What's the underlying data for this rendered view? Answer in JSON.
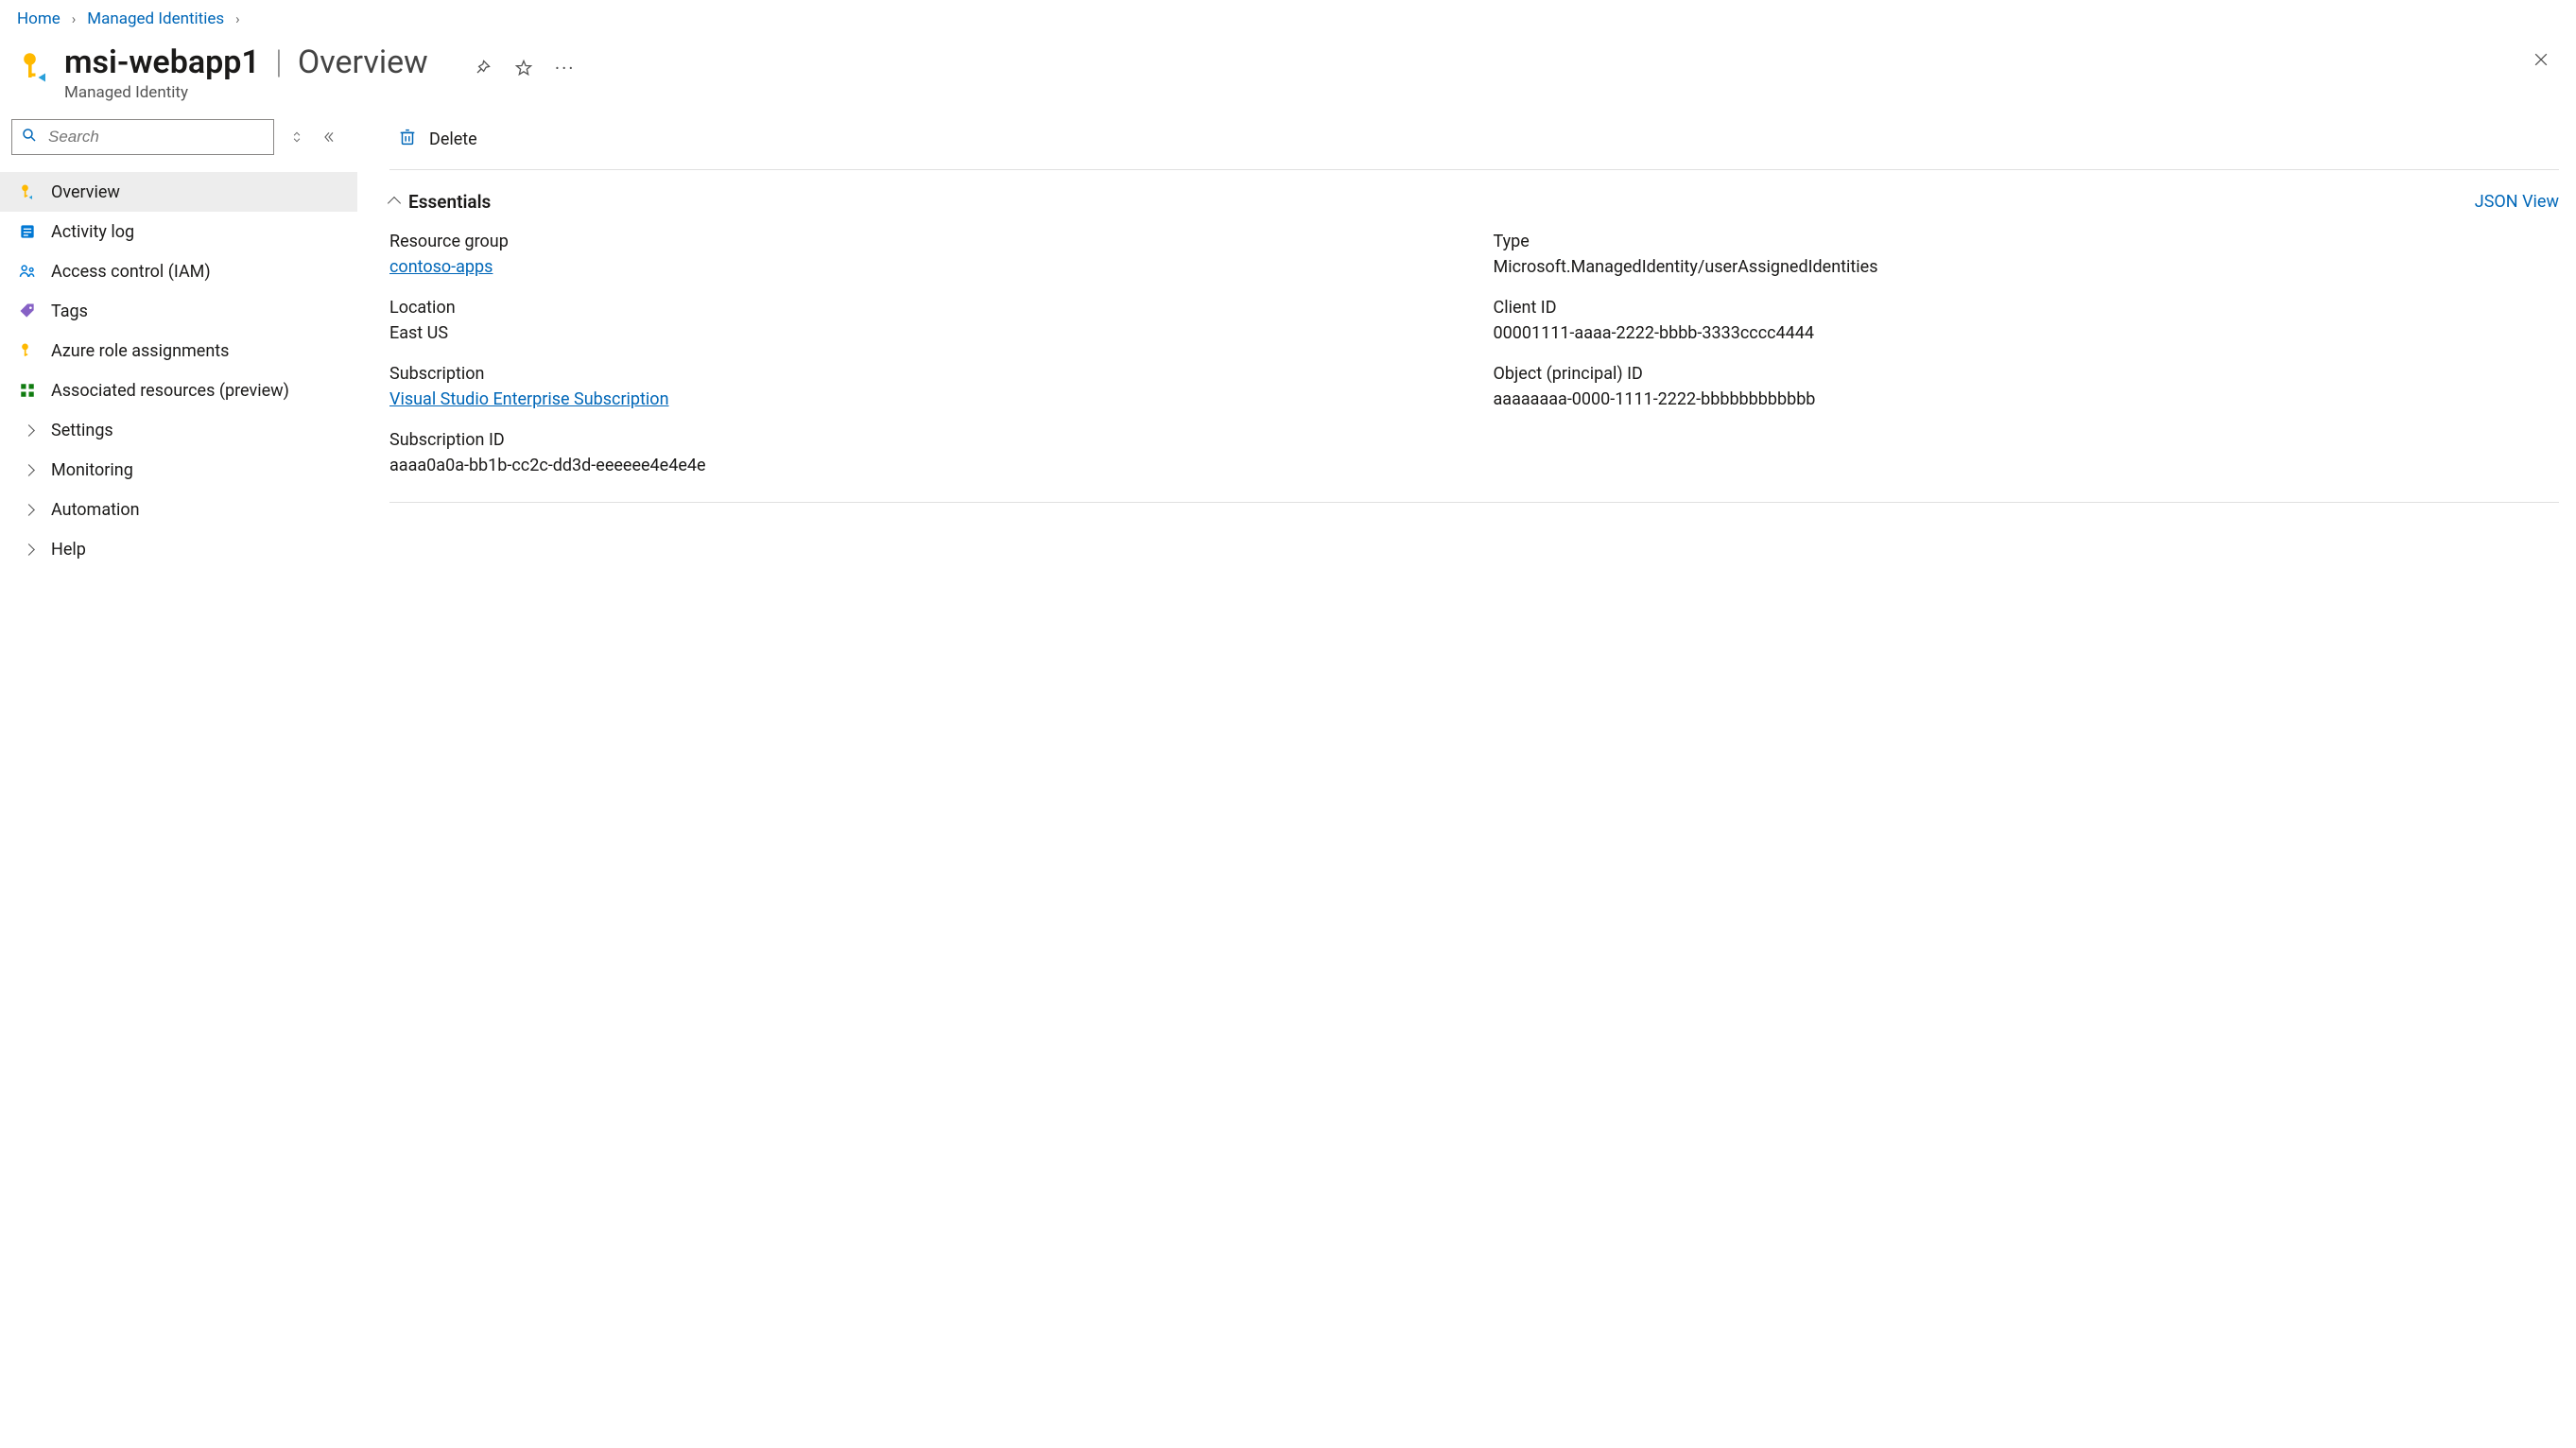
{
  "breadcrumb": {
    "items": [
      "Home",
      "Managed Identities"
    ]
  },
  "header": {
    "resource_name": "msi-webapp1",
    "page_name": "Overview",
    "subtitle": "Managed Identity"
  },
  "sidebar": {
    "search_placeholder": "Search",
    "items": [
      {
        "label": "Overview",
        "icon": "key",
        "active": true
      },
      {
        "label": "Activity log",
        "icon": "log",
        "active": false
      },
      {
        "label": "Access control (IAM)",
        "icon": "iam",
        "active": false
      },
      {
        "label": "Tags",
        "icon": "tag",
        "active": false
      },
      {
        "label": "Azure role assignments",
        "icon": "key",
        "active": false
      },
      {
        "label": "Associated resources (preview)",
        "icon": "grid",
        "active": false
      },
      {
        "label": "Settings",
        "icon": "chevron",
        "active": false
      },
      {
        "label": "Monitoring",
        "icon": "chevron",
        "active": false
      },
      {
        "label": "Automation",
        "icon": "chevron",
        "active": false
      },
      {
        "label": "Help",
        "icon": "chevron",
        "active": false
      }
    ]
  },
  "toolbar": {
    "delete_label": "Delete"
  },
  "essentials": {
    "title": "Essentials",
    "json_view_label": "JSON View",
    "fields": {
      "resource_group_label": "Resource group",
      "resource_group_value": "contoso-apps",
      "type_label": "Type",
      "type_value": "Microsoft.ManagedIdentity/userAssignedIdentities",
      "location_label": "Location",
      "location_value": "East US",
      "client_id_label": "Client ID",
      "client_id_value": "00001111-aaaa-2222-bbbb-3333cccc4444",
      "subscription_label": "Subscription",
      "subscription_value": "Visual Studio Enterprise Subscription",
      "object_id_label": "Object (principal) ID",
      "object_id_value": "aaaaaaaa-0000-1111-2222-bbbbbbbbbbbb",
      "subscription_id_label": "Subscription ID",
      "subscription_id_value": "aaaa0a0a-bb1b-cc2c-dd3d-eeeeee4e4e4e"
    }
  }
}
